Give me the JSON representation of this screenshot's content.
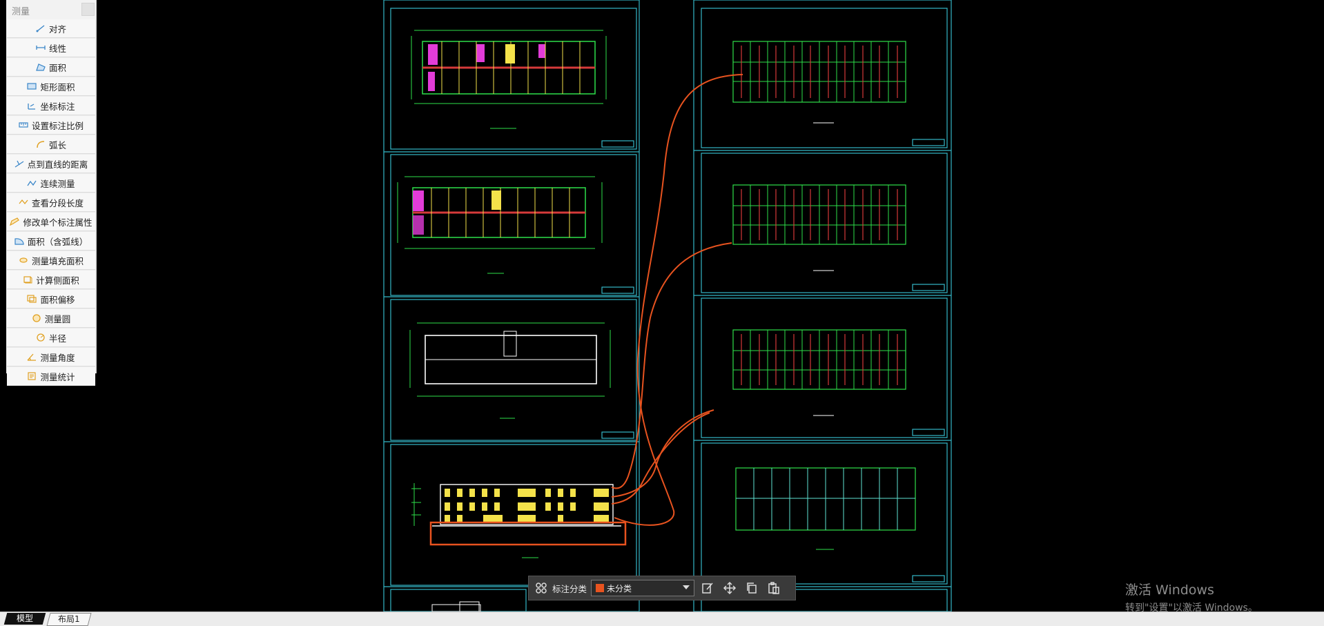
{
  "panel": {
    "title": "测量",
    "tools": [
      {
        "label": "对齐",
        "icon": "align-measure-icon"
      },
      {
        "label": "线性",
        "icon": "linear-measure-icon"
      },
      {
        "label": "面积",
        "icon": "area-icon"
      },
      {
        "label": "矩形面积",
        "icon": "rect-area-icon"
      },
      {
        "label": "坐标标注",
        "icon": "coordinate-icon"
      },
      {
        "label": "设置标注比例",
        "icon": "scale-icon"
      },
      {
        "label": "弧长",
        "icon": "arc-length-icon"
      },
      {
        "label": "点到直线的距离",
        "icon": "point-line-distance-icon"
      },
      {
        "label": "连续测量",
        "icon": "continuous-measure-icon"
      },
      {
        "label": "查看分段长度",
        "icon": "segment-length-icon"
      },
      {
        "label": "修改单个标注属性",
        "icon": "edit-annotation-icon"
      },
      {
        "label": "面积（含弧线）",
        "icon": "arc-area-icon"
      },
      {
        "label": "测量填充面积",
        "icon": "fill-area-icon"
      },
      {
        "label": "计算侧面积",
        "icon": "side-area-icon"
      },
      {
        "label": "面积偏移",
        "icon": "area-offset-icon"
      },
      {
        "label": "测量圆",
        "icon": "circle-measure-icon"
      },
      {
        "label": "半径",
        "icon": "radius-icon"
      },
      {
        "label": "测量角度",
        "icon": "angle-icon"
      },
      {
        "label": "测量统计",
        "icon": "statistics-icon"
      }
    ]
  },
  "annotation_bar": {
    "label": "标注分类",
    "selected": "未分类",
    "selected_color": "#e8531f",
    "buttons": [
      "edit-icon",
      "move-icon",
      "copy-icon",
      "paste-icon"
    ]
  },
  "watermark": {
    "title": "激活 Windows",
    "subtitle": "转到\"设置\"以激活 Windows。"
  },
  "tabs": [
    {
      "label": "模型",
      "active": true
    },
    {
      "label": "布局1",
      "active": false
    }
  ],
  "colors": {
    "canvas_bg": "#000000",
    "frame": "#34b8c8",
    "plan_green": "#2ee04a",
    "plan_yellow": "#f4e24a",
    "plan_magenta": "#e23cd8",
    "plan_red": "#d63a3a",
    "annotation_orange": "#e8531f"
  }
}
